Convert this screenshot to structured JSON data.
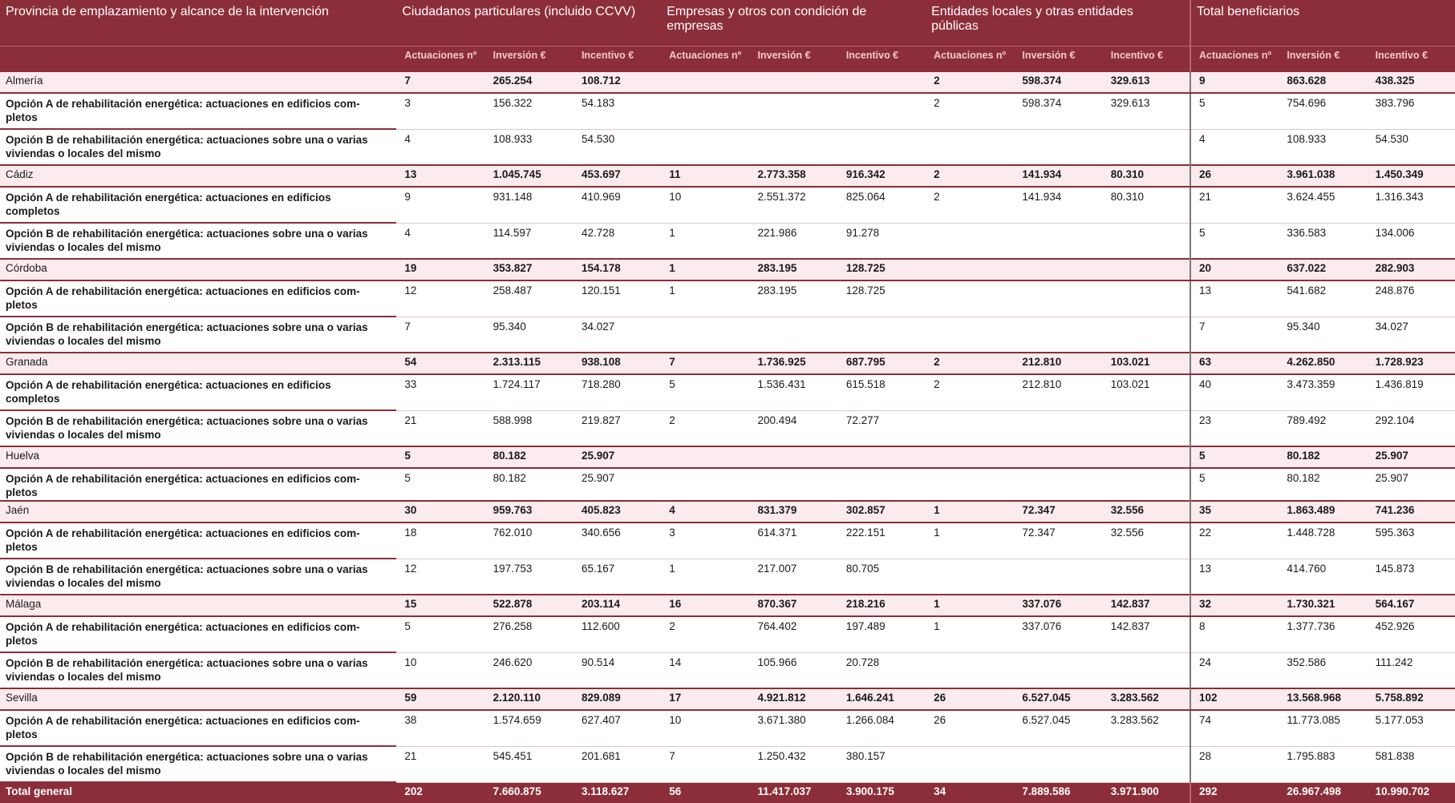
{
  "header": {
    "col0": "Provincia de emplazamiento y alcance de la intervención",
    "groups": [
      "Ciudadanos particulares (incluido CCVV)",
      "Empresas y otros con condición de empresas",
      "Entidades locales y otras entidades públicas",
      "Total beneficiarios"
    ],
    "sub": [
      "Actuaciones nº",
      "Inversión €",
      "Incentivo €"
    ]
  },
  "rows": [
    {
      "type": "prov",
      "label": "Almería",
      "v": [
        "7",
        "265.254",
        "108.712",
        "",
        "",
        "",
        "2",
        "598.374",
        "329.613",
        "9",
        "863.628",
        "438.325"
      ]
    },
    {
      "type": "opt",
      "label": "Opción A de rehabilitación energética: actuaciones en edificios com-pletos",
      "label_lines": [
        "Opción A de rehabilitación energética: actuaciones en edificios com-",
        "pletos"
      ],
      "v": [
        "3",
        "156.322",
        "54.183",
        "",
        "",
        "",
        "2",
        "598.374",
        "329.613",
        "5",
        "754.696",
        "383.796"
      ]
    },
    {
      "type": "opt",
      "label_lines": [
        "Opción B de rehabilitación energética: actuaciones sobre una o varias",
        "viviendas o locales del mismo"
      ],
      "v": [
        "4",
        "108.933",
        "54.530",
        "",
        "",
        "",
        "",
        "",
        "",
        "4",
        "108.933",
        "54.530"
      ]
    },
    {
      "type": "prov",
      "label": "Cádiz",
      "v": [
        "13",
        "1.045.745",
        "453.697",
        "11",
        "2.773.358",
        "916.342",
        "2",
        "141.934",
        "80.310",
        "26",
        "3.961.038",
        "1.450.349"
      ]
    },
    {
      "type": "opt",
      "label_lines": [
        "Opción A de rehabilitación energética: actuaciones en edificios",
        "completos"
      ],
      "v": [
        "9",
        "931.148",
        "410.969",
        "10",
        "2.551.372",
        "825.064",
        "2",
        "141.934",
        "80.310",
        "21",
        "3.624.455",
        "1.316.343"
      ]
    },
    {
      "type": "opt",
      "label_lines": [
        "Opción B de rehabilitación energética: actuaciones sobre una o varias",
        "viviendas o locales del mismo"
      ],
      "v": [
        "4",
        "114.597",
        "42.728",
        "1",
        "221.986",
        "91.278",
        "",
        "",
        "",
        "5",
        "336.583",
        "134.006"
      ]
    },
    {
      "type": "prov",
      "label": "Córdoba",
      "v": [
        "19",
        "353.827",
        "154.178",
        "1",
        "283.195",
        "128.725",
        "",
        "",
        "",
        "20",
        "637.022",
        "282.903"
      ]
    },
    {
      "type": "opt",
      "label_lines": [
        "Opción A de rehabilitación energética: actuaciones en edificios com-",
        "pletos"
      ],
      "v": [
        "12",
        "258.487",
        "120.151",
        "1",
        "283.195",
        "128.725",
        "",
        "",
        "",
        "13",
        "541.682",
        "248.876"
      ]
    },
    {
      "type": "opt",
      "label_lines": [
        "Opción B de rehabilitación energética: actuaciones sobre una o varias",
        "viviendas o locales del mismo"
      ],
      "v": [
        "7",
        "95.340",
        "34.027",
        "",
        "",
        "",
        "",
        "",
        "",
        "7",
        "95.340",
        "34.027"
      ]
    },
    {
      "type": "prov",
      "label": "Granada",
      "v": [
        "54",
        "2.313.115",
        "938.108",
        "7",
        "1.736.925",
        "687.795",
        "2",
        "212.810",
        "103.021",
        "63",
        "4.262.850",
        "1.728.923"
      ]
    },
    {
      "type": "opt",
      "label_lines": [
        "Opción A de rehabilitación energética: actuaciones en edificios",
        "completos"
      ],
      "v": [
        "33",
        "1.724.117",
        "718.280",
        "5",
        "1.536.431",
        "615.518",
        "2",
        "212.810",
        "103.021",
        "40",
        "3.473.359",
        "1.436.819"
      ]
    },
    {
      "type": "opt",
      "label_lines": [
        "Opción B de rehabilitación energética: actuaciones sobre una o varias",
        "viviendas o locales del mismo"
      ],
      "v": [
        "21",
        "588.998",
        "219.827",
        "2",
        "200.494",
        "72.277",
        "",
        "",
        "",
        "23",
        "789.492",
        "292.104"
      ]
    },
    {
      "type": "prov",
      "label": "Huelva",
      "v": [
        "5",
        "80.182",
        "25.907",
        "",
        "",
        "",
        "",
        "",
        "",
        "5",
        "80.182",
        "25.907"
      ]
    },
    {
      "type": "opt",
      "single": true,
      "label_lines": [
        "Opción A de rehabilitación energética: actuaciones en edificios com-",
        "pletos"
      ],
      "v": [
        "5",
        "80.182",
        "25.907",
        "",
        "",
        "",
        "",
        "",
        "",
        "5",
        "80.182",
        "25.907"
      ]
    },
    {
      "type": "prov",
      "label": "Jaén",
      "v": [
        "30",
        "959.763",
        "405.823",
        "4",
        "831.379",
        "302.857",
        "1",
        "72.347",
        "32.556",
        "35",
        "1.863.489",
        "741.236"
      ]
    },
    {
      "type": "opt",
      "label_lines": [
        "Opción A de rehabilitación energética: actuaciones en edificios com-",
        "pletos"
      ],
      "v": [
        "18",
        "762.010",
        "340.656",
        "3",
        "614.371",
        "222.151",
        "1",
        "72.347",
        "32.556",
        "22",
        "1.448.728",
        "595.363"
      ]
    },
    {
      "type": "opt",
      "label_lines": [
        "Opción B de rehabilitación energética: actuaciones sobre una o varias",
        "viviendas o locales del mismo"
      ],
      "v": [
        "12",
        "197.753",
        "65.167",
        "1",
        "217.007",
        "80.705",
        "",
        "",
        "",
        "13",
        "414.760",
        "145.873"
      ]
    },
    {
      "type": "prov",
      "label": "Málaga",
      "v": [
        "15",
        "522.878",
        "203.114",
        "16",
        "870.367",
        "218.216",
        "1",
        "337.076",
        "142.837",
        "32",
        "1.730.321",
        "564.167"
      ]
    },
    {
      "type": "opt",
      "label_lines": [
        "Opción A de rehabilitación energética: actuaciones en edificios com-",
        "pletos"
      ],
      "v": [
        "5",
        "276.258",
        "112.600",
        "2",
        "764.402",
        "197.489",
        "1",
        "337.076",
        "142.837",
        "8",
        "1.377.736",
        "452.926"
      ]
    },
    {
      "type": "opt",
      "label_lines": [
        "Opción B de rehabilitación energética: actuaciones sobre una o varias",
        "viviendas o locales del mismo"
      ],
      "v": [
        "10",
        "246.620",
        "90.514",
        "14",
        "105.966",
        "20.728",
        "",
        "",
        "",
        "24",
        "352.586",
        "111.242"
      ]
    },
    {
      "type": "prov",
      "label": "Sevilla",
      "v": [
        "59",
        "2.120.110",
        "829.089",
        "17",
        "4.921.812",
        "1.646.241",
        "26",
        "6.527.045",
        "3.283.562",
        "102",
        "13.568.968",
        "5.758.892"
      ]
    },
    {
      "type": "opt",
      "label_lines": [
        "Opción A de rehabilitación energética: actuaciones en edificios com-",
        "pletos"
      ],
      "v": [
        "38",
        "1.574.659",
        "627.407",
        "10",
        "3.671.380",
        "1.266.084",
        "26",
        "6.527.045",
        "3.283.562",
        "74",
        "11.773.085",
        "5.177.053"
      ]
    },
    {
      "type": "opt",
      "label_lines": [
        "Opción B de rehabilitación energética: actuaciones sobre una o varias",
        "viviendas o locales del mismo"
      ],
      "v": [
        "21",
        "545.451",
        "201.681",
        "7",
        "1.250.432",
        "380.157",
        "",
        "",
        "",
        "28",
        "1.795.883",
        "581.838"
      ]
    },
    {
      "type": "total",
      "label": "Total general",
      "v": [
        "202",
        "7.660.875",
        "3.118.627",
        "56",
        "11.417.037",
        "3.900.175",
        "34",
        "7.889.586",
        "3.971.900",
        "292",
        "26.967.498",
        "10.990.702"
      ]
    }
  ]
}
